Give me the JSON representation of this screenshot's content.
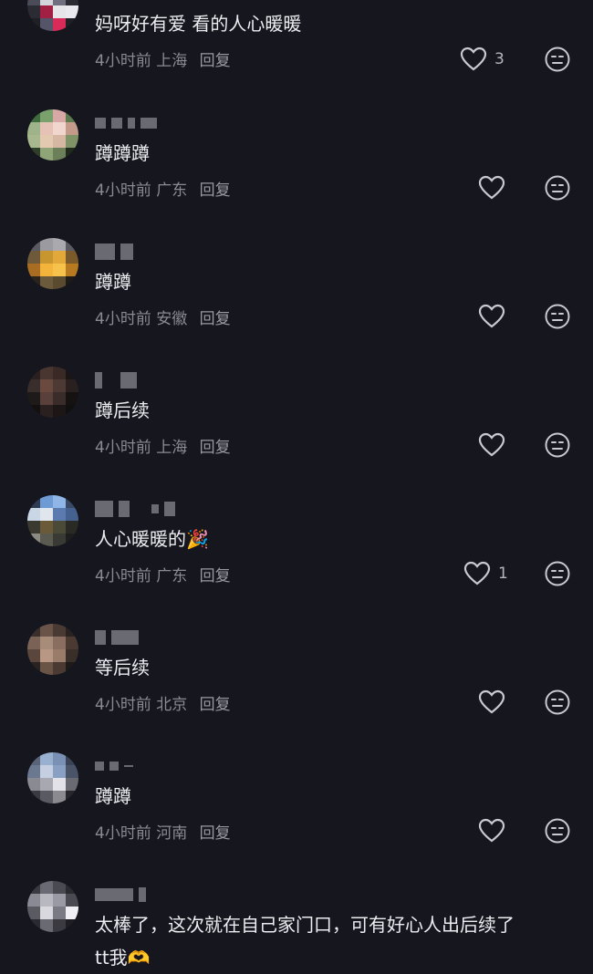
{
  "comments": [
    {
      "text": "妈呀好有爱 看的人心暖暖",
      "time": "4小时前",
      "location": "上海",
      "reply": "回复",
      "likes": "3"
    },
    {
      "text": "蹲蹲蹲",
      "time": "4小时前",
      "location": "广东",
      "reply": "回复",
      "likes": ""
    },
    {
      "text": "蹲蹲",
      "time": "4小时前",
      "location": "安徽",
      "reply": "回复",
      "likes": ""
    },
    {
      "text": "蹲后续",
      "time": "4小时前",
      "location": "上海",
      "reply": "回复",
      "likes": ""
    },
    {
      "text": "人心暖暖的🎉",
      "time": "4小时前",
      "location": "广东",
      "reply": "回复",
      "likes": "1"
    },
    {
      "text": "等后续",
      "time": "4小时前",
      "location": "北京",
      "reply": "回复",
      "likes": ""
    },
    {
      "text": "蹲蹲",
      "time": "4小时前",
      "location": "河南",
      "reply": "回复",
      "likes": ""
    },
    {
      "text": "太棒了，这次就在自己家门口，可有好心人出后续了",
      "text2": "tt我🫶",
      "time": "",
      "location": "",
      "reply": "",
      "likes": ""
    }
  ],
  "icons": {
    "like": "heart-outline-icon",
    "dislike": "neutral-face-icon"
  },
  "colors": {
    "background": "#16161e",
    "text": "#ececf1",
    "meta": "#8a8a93"
  }
}
